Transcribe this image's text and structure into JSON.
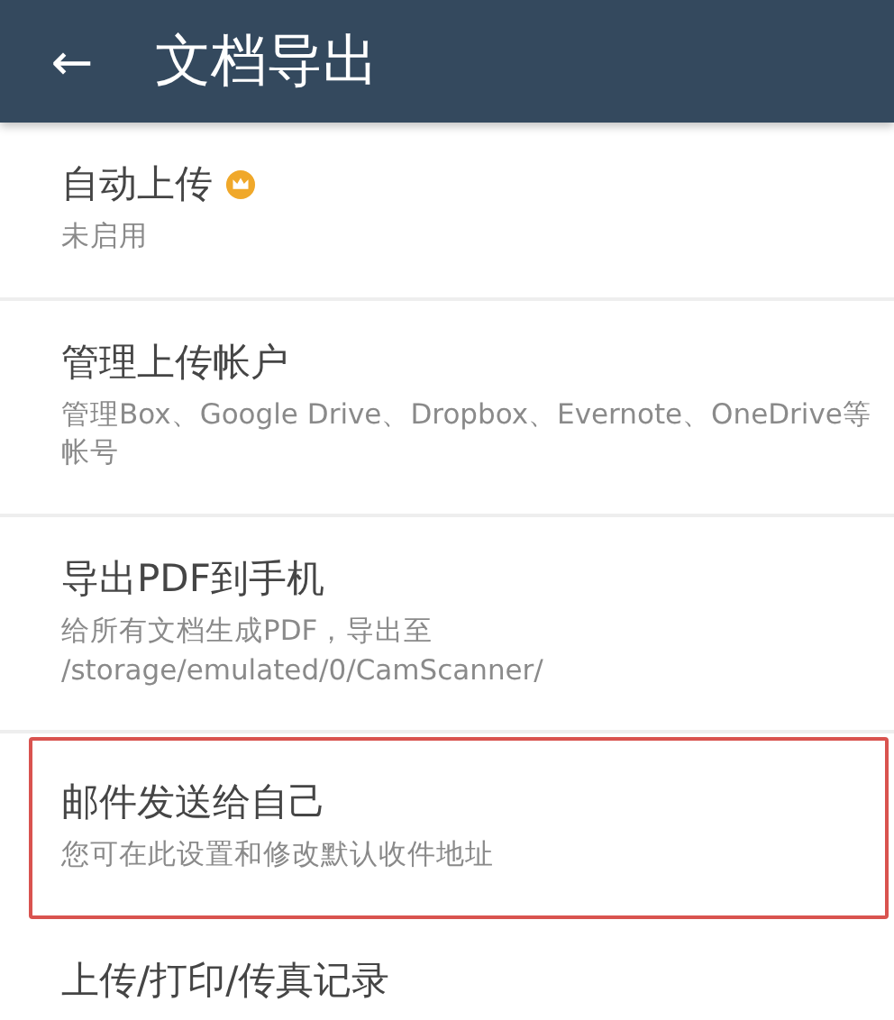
{
  "header": {
    "back_icon": "←",
    "title": "文档导出"
  },
  "items": [
    {
      "title": "自动上传",
      "premium": true,
      "subtitle": "未启用",
      "highlighted": false
    },
    {
      "title": "管理上传帐户",
      "premium": false,
      "subtitle": "管理Box、Google Drive、Dropbox、Evernote、OneDrive等帐号",
      "highlighted": false
    },
    {
      "title": "导出PDF到手机",
      "premium": false,
      "subtitle": "给所有文档生成PDF，导出至 /storage/emulated/0/CamScanner/",
      "highlighted": false
    },
    {
      "title": "邮件发送给自己",
      "premium": false,
      "subtitle": "您可在此设置和修改默认收件地址",
      "highlighted": true
    },
    {
      "title": "上传/打印/传真记录",
      "premium": false,
      "highlighted": false
    }
  ]
}
